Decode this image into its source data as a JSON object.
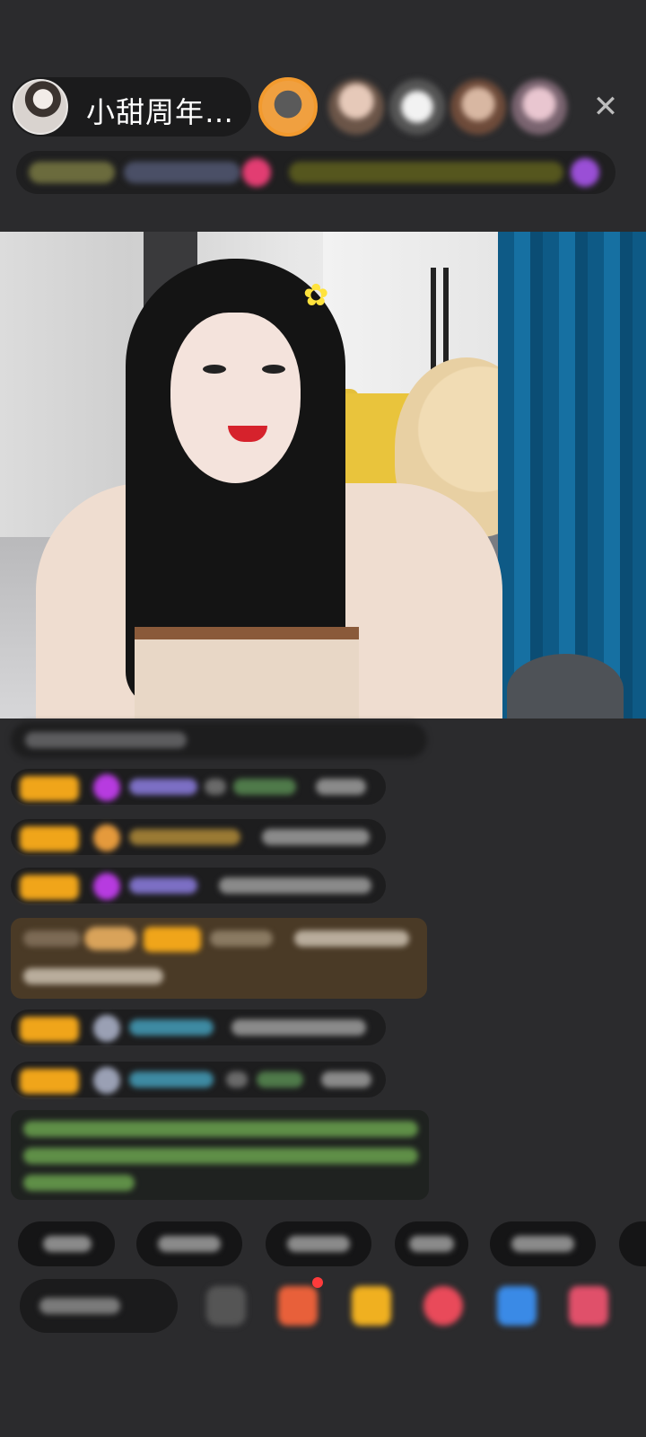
{
  "header": {
    "host_name": "小甜周年…",
    "close_glyph": "✕"
  },
  "colors": {
    "background": "#2b2b2d",
    "badge_orange": "#f0a51a",
    "highlight_bg": "#4a3a26",
    "notice_text": "#8fd46a"
  }
}
